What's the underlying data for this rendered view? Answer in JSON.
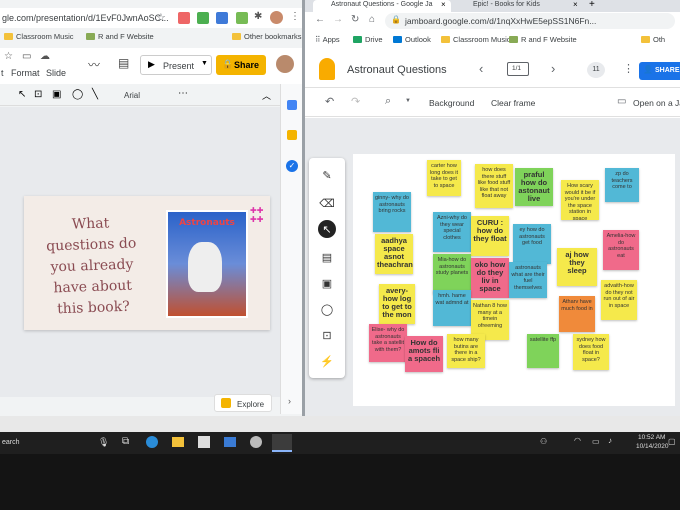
{
  "left": {
    "url": "gle.com/presentation/d/1EvF0JwnAoSC...",
    "bookmarks": [
      "Classroom Music",
      "R and F Website",
      "Other bookmarks"
    ],
    "menu": [
      "t",
      "Format",
      "Slide"
    ],
    "present_label": "Present",
    "share_label": "Share",
    "font_name": "Arial",
    "slide_text": "What questions do you already have about this book?",
    "book_title": "Astronauts",
    "explore_label": "Explore",
    "search_text": "earch"
  },
  "right": {
    "tabs": [
      "Astronaut Questions - Google Ja",
      "Epic! - Books for Kids"
    ],
    "url": "jamboard.google.com/d/1nqXxHwE5epSS1N6Fn...",
    "bookmarks": [
      "Apps",
      "Drive",
      "Outlook",
      "Classroom Music",
      "R and F Website",
      "Oth"
    ],
    "title": "Astronaut Questions",
    "frame_counter": "1/1",
    "frame_count_badge": "11",
    "share_label": "SHARE",
    "background_label": "Background",
    "clear_label": "Clear frame",
    "open_label": "Open on a Ja",
    "notes": [
      {
        "text": "carter how long does it take to get to space",
        "color": "#f5e94b"
      },
      {
        "text": "how does there stuff like food stuff like that not float away",
        "color": "#f5e94b"
      },
      {
        "text": "praful how do astonaut live",
        "color": "#7fd35a"
      },
      {
        "text": "How scary would it be if you're under the space station in space",
        "color": "#f5e94b"
      },
      {
        "text": "zp do teachers come to",
        "color": "#52b8d6"
      },
      {
        "text": "ginny- why do astronauts bring rocks",
        "color": "#52b8d6"
      },
      {
        "text": "Azni-why do they wear special clothes",
        "color": "#52b8d6"
      },
      {
        "text": "CURU : how do they float",
        "color": "#f5e94b"
      },
      {
        "text": "ey how do astronauts get food",
        "color": "#52b8d6"
      },
      {
        "text": "Amelia-how do astronauts eat",
        "color": "#f06a8a"
      },
      {
        "text": "aadhya space asnot theachran",
        "color": "#f5e94b"
      },
      {
        "text": "Mia-how do astronauts study planets",
        "color": "#7fd35a"
      },
      {
        "text": "oko how do they liv in space",
        "color": "#f06a8a"
      },
      {
        "text": "astronauts what are their fuel themselves",
        "color": "#52b8d6"
      },
      {
        "text": "aj how they sleep",
        "color": "#f5e94b"
      },
      {
        "text": "advaith-how do they not run out of air in space",
        "color": "#f5e94b"
      },
      {
        "text": "avery-how log to get to the mon",
        "color": "#f5e94b"
      },
      {
        "text": "hmh. hame wat admnd at",
        "color": "#52b8d6"
      },
      {
        "text": "Nathan 8 how many at a timein ofreeming",
        "color": "#f5e94b"
      },
      {
        "text": "Atharv have much food in",
        "color": "#f08a3a"
      },
      {
        "text": "Elise- why do astronauts take a satellit with them?",
        "color": "#f06a8a"
      },
      {
        "text": "How do amots fli a spaceh",
        "color": "#f06a8a"
      },
      {
        "text": "how many butins are there in a space ship?",
        "color": "#f5e94b"
      },
      {
        "text": "satellite ffp",
        "color": "#7fd35a"
      },
      {
        "text": "sydney how does food float in space?",
        "color": "#f5e94b"
      }
    ]
  },
  "taskbar": {
    "time": "10:52 AM",
    "date": "10/14/2020"
  }
}
